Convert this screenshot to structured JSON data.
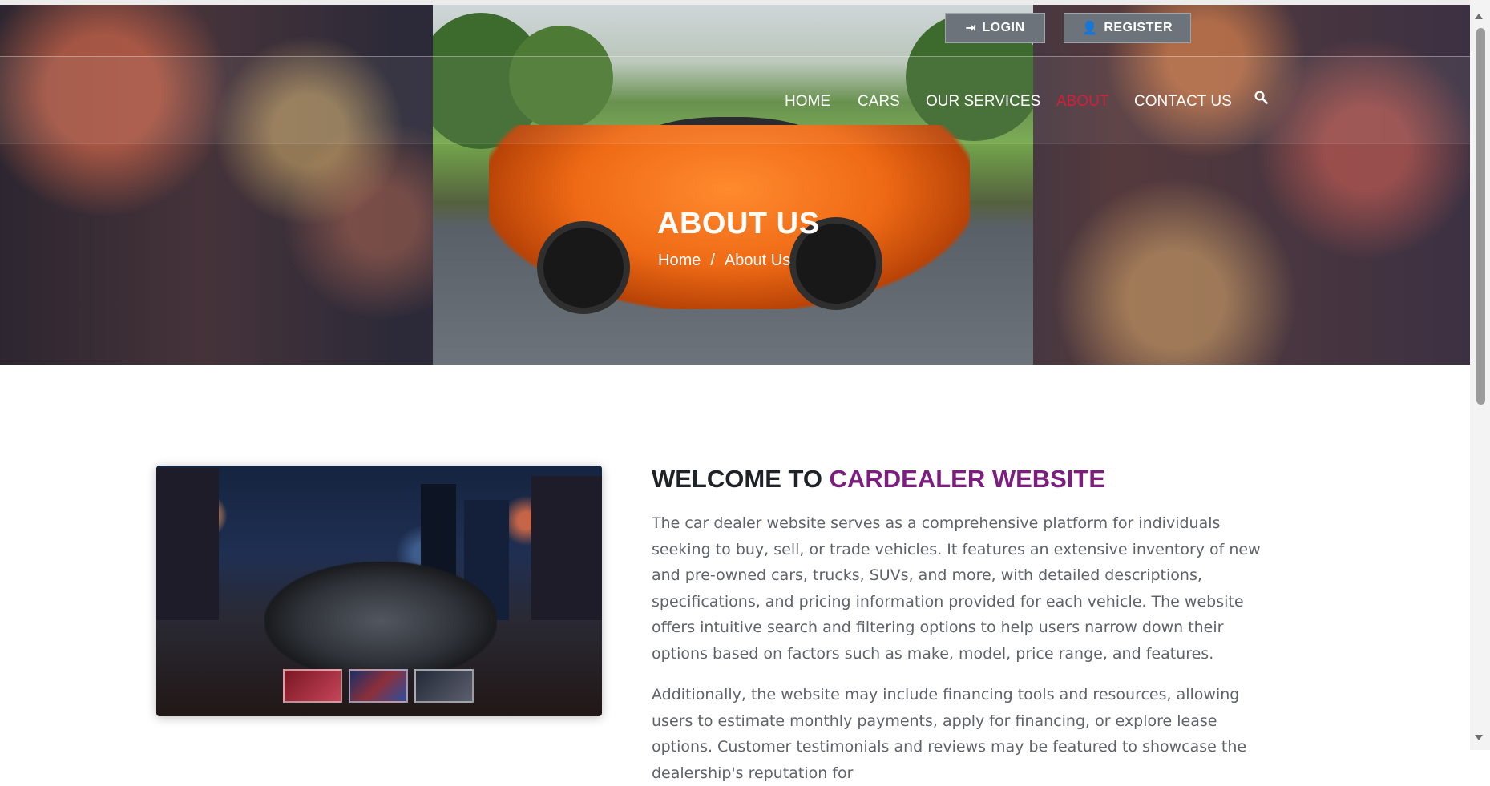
{
  "header": {
    "login_label": "LOGIN",
    "register_label": "REGISTER",
    "nav": [
      {
        "label": "HOME",
        "active": false
      },
      {
        "label": "CARS",
        "active": false
      },
      {
        "label": "OUR SERVICES",
        "active": false
      },
      {
        "label": "ABOUT",
        "active": true
      },
      {
        "label": "CONTACT US",
        "active": false
      }
    ],
    "search_icon": "search-icon"
  },
  "hero": {
    "title": "ABOUT US",
    "breadcrumb": {
      "home": "Home",
      "separator": "/",
      "current": "About Us"
    }
  },
  "content": {
    "heading_prefix": "WELCOME TO ",
    "heading_accent": "CARDEALER WEBSITE",
    "paragraph1": "The car dealer website serves as a comprehensive platform for individuals seeking to buy, sell, or trade vehicles. It features an extensive inventory of new and pre-owned cars, trucks, SUVs, and more, with detailed descriptions, specifications, and pricing information provided for each vehicle. The website offers intuitive search and filtering options to help users narrow down their options based on factors such as make, model, price range, and features.",
    "paragraph2": "Additionally, the website may include financing tools and resources, allowing users to estimate monthly payments, apply for financing, or explore lease options. Customer testimonials and reviews may be featured to showcase the dealership's reputation for"
  },
  "colors": {
    "active_nav": "#d32039",
    "heading_accent": "#7c1d7f",
    "button": "#6c737b"
  }
}
